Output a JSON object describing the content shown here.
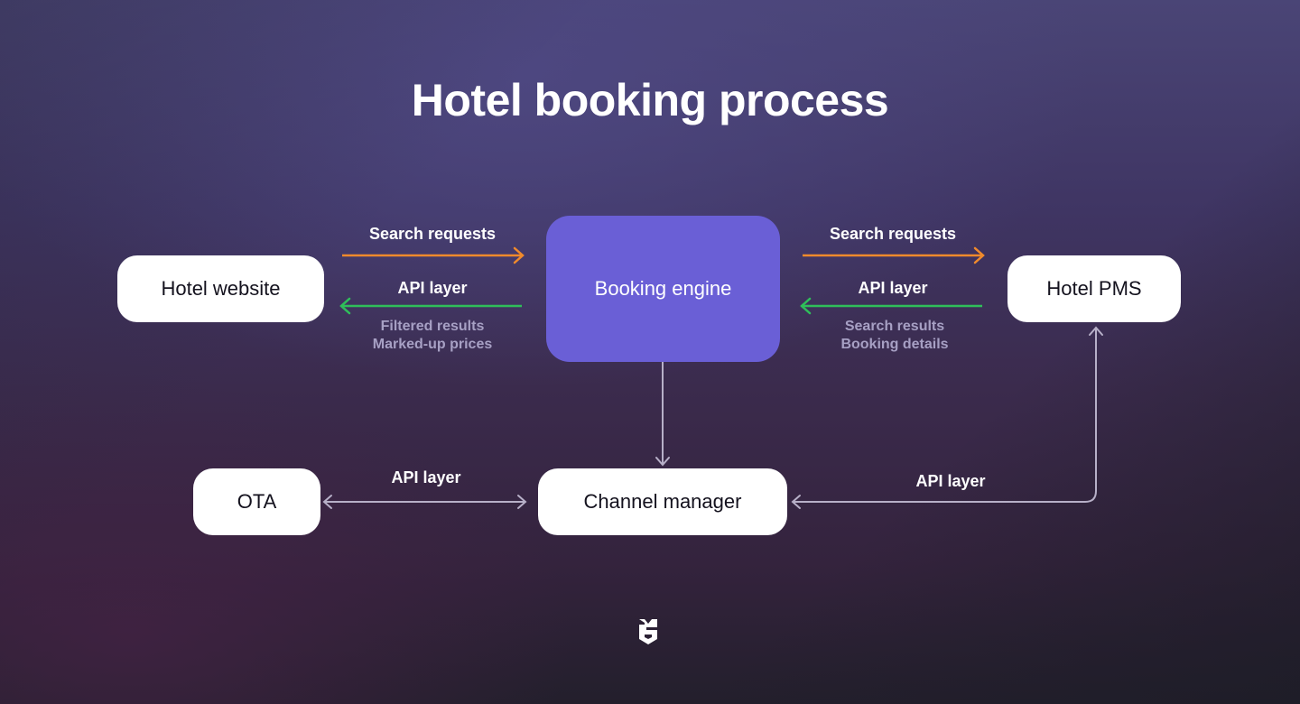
{
  "title": "Hotel booking process",
  "colors": {
    "request_arrow": "#f08a2c",
    "response_arrow": "#2fbf5a",
    "connector": "#b7b0c8",
    "booking_engine": "#6a5fd6",
    "node": "#ffffff"
  },
  "nodes": {
    "hotel_website": "Hotel website",
    "booking_engine": "Booking engine",
    "hotel_pms": "Hotel PMS",
    "ota": "OTA",
    "channel_manager": "Channel manager"
  },
  "edges": {
    "website_engine": {
      "request_label": "Search requests",
      "response_label": "API layer",
      "response_details": [
        "Filtered results",
        "Marked-up prices"
      ]
    },
    "engine_pms": {
      "request_label": "Search requests",
      "response_label": "API layer",
      "response_details": [
        "Search results",
        "Booking details"
      ]
    },
    "ota_channel": {
      "label": "API layer",
      "direction": "bidirectional"
    },
    "pms_channel": {
      "label": "API layer",
      "direction": "pms-to-channel-manager"
    },
    "engine_channel": {
      "direction": "engine-to-channel-manager"
    }
  },
  "logo": "s-shield-logo"
}
